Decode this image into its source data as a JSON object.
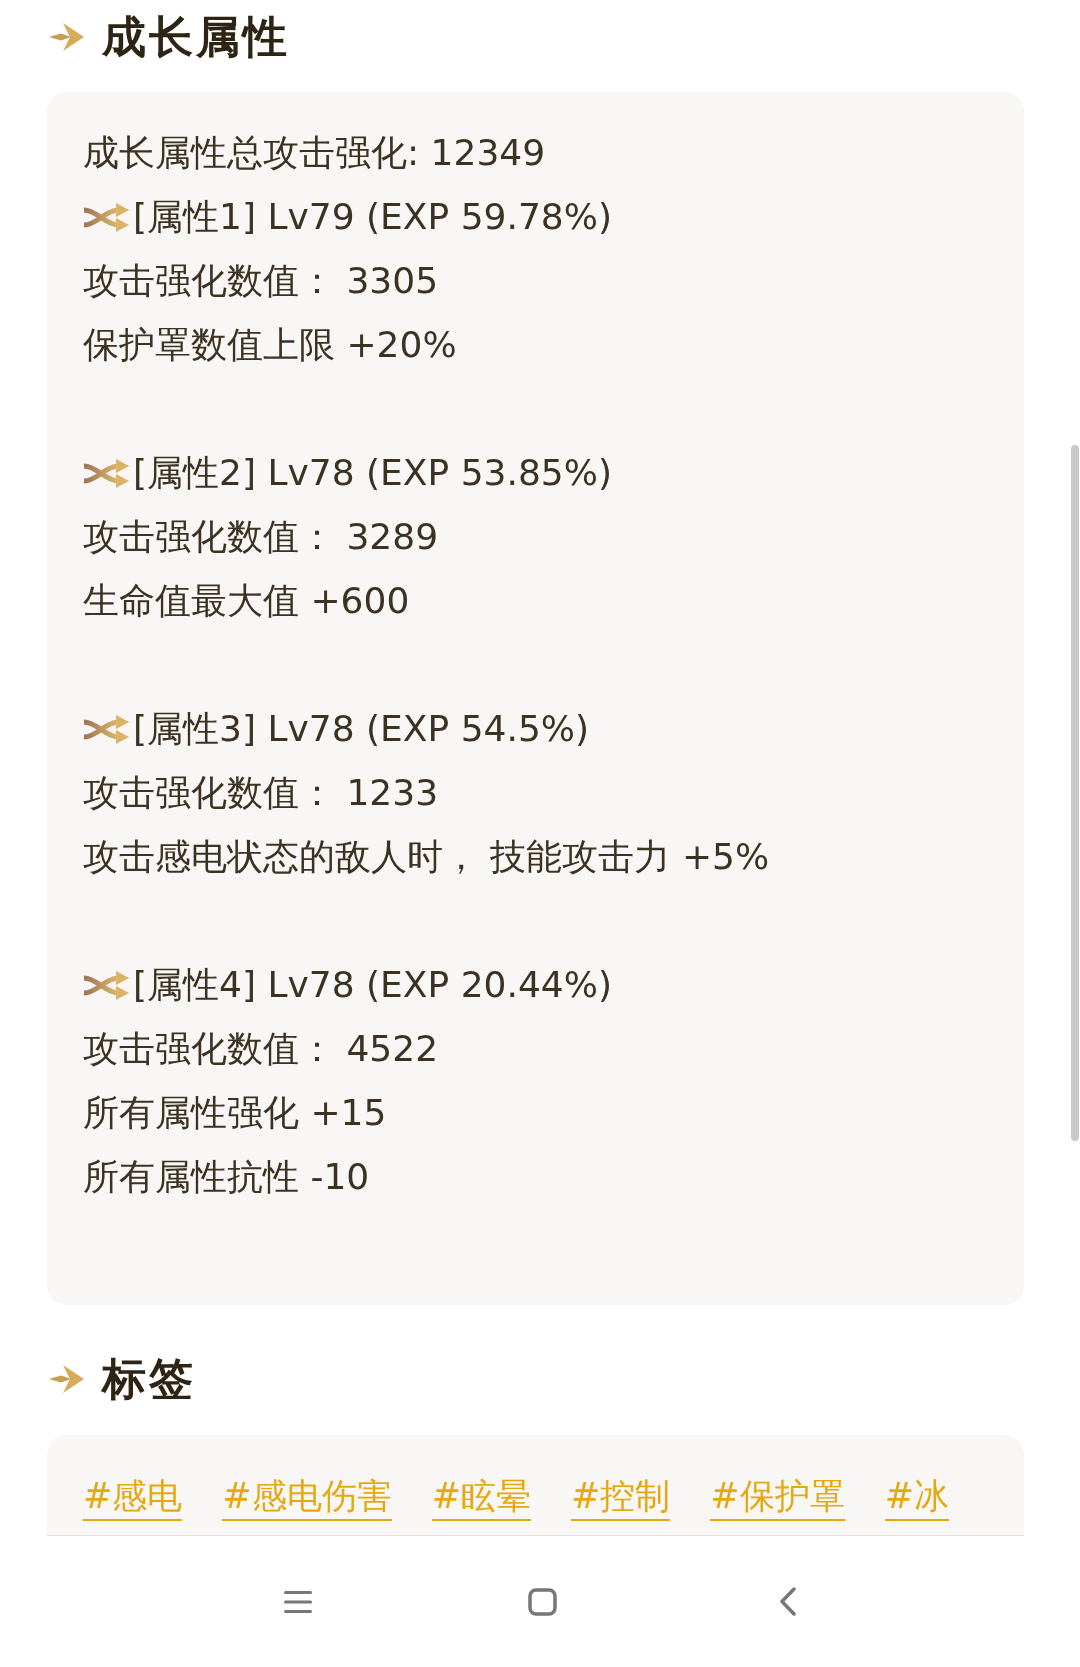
{
  "sections": [
    {
      "kind": "stats",
      "title": "成长属性",
      "summary": "成长属性总攻击强化: 12349",
      "attributes": [
        {
          "header": "[属性1] Lv79 (EXP 59.78%)",
          "lines": [
            "攻击强化数值： 3305",
            "保护罩数值上限 +20%"
          ]
        },
        {
          "header": "[属性2] Lv78 (EXP 53.85%)",
          "lines": [
            "攻击强化数值： 3289",
            "生命值最大值 +600"
          ]
        },
        {
          "header": "[属性3] Lv78 (EXP 54.5%)",
          "lines": [
            "攻击强化数值： 1233",
            "攻击感电状态的敌人时， 技能攻击力 +5%"
          ]
        },
        {
          "header": "[属性4] Lv78 (EXP 20.44%)",
          "lines": [
            "攻击强化数值： 4522",
            "所有属性强化 +15",
            "所有属性抗性 -10"
          ]
        }
      ]
    },
    {
      "kind": "tags",
      "title": "标签",
      "tags": [
        "#感电",
        "#感电伤害",
        "#眩晕",
        "#控制",
        "#保护罩",
        "#冰"
      ]
    }
  ]
}
